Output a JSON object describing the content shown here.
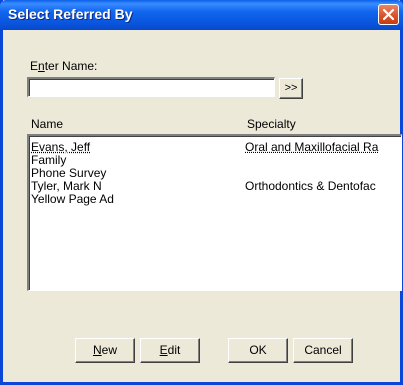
{
  "window": {
    "title": "Select Referred By"
  },
  "search": {
    "label_prefix": "E",
    "label_access": "n",
    "label_suffix": "ter Name:",
    "value": "",
    "go_label": ">>"
  },
  "columns": {
    "name": "Name",
    "specialty": "Specialty"
  },
  "list": {
    "rows": [
      {
        "name": "Evans, Jeff",
        "specialty": "Oral and Maxillofacial Ra"
      },
      {
        "name": "Family",
        "specialty": ""
      },
      {
        "name": "Phone Survey",
        "specialty": ""
      },
      {
        "name": "Tyler, Mark N",
        "specialty": "Orthodontics & Dentofac"
      },
      {
        "name": "Yellow Page Ad",
        "specialty": ""
      }
    ]
  },
  "buttons": {
    "new_access": "N",
    "new_rest": "ew",
    "edit_access": "E",
    "edit_rest": "dit",
    "ok": "OK",
    "cancel": "Cancel"
  }
}
